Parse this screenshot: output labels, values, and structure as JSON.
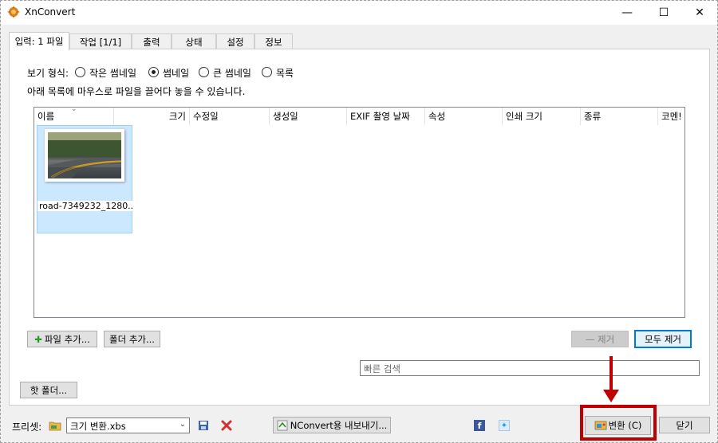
{
  "window": {
    "title": "XnConvert",
    "minimize": "—",
    "maximize": "☐",
    "close": "✕"
  },
  "tabs": [
    {
      "label": "입력: 1 파일",
      "active": true
    },
    {
      "label": "작업 [1/1]",
      "active": false
    },
    {
      "label": "출력",
      "active": false
    },
    {
      "label": "상태",
      "active": false
    },
    {
      "label": "설정",
      "active": false
    },
    {
      "label": "정보",
      "active": false
    }
  ],
  "view": {
    "label": "보기 형식:",
    "options": [
      {
        "label": "작은 썸네일",
        "selected": false
      },
      {
        "label": "썸네일",
        "selected": true
      },
      {
        "label": "큰 썸네일",
        "selected": false
      },
      {
        "label": "목록",
        "selected": false
      }
    ],
    "hint": "아래 목록에 마우스로 파일을 끌어다 놓을 수 있습니다."
  },
  "list": {
    "columns": [
      "이름",
      "크기",
      "수정일",
      "생성일",
      "EXIF 촬영 날짜",
      "속성",
      "인쇄 크기",
      "종류",
      "코멘!"
    ],
    "items": [
      {
        "caption": "road-7349232_1280..."
      }
    ]
  },
  "buttons": {
    "add_files": "파일 추가...",
    "add_folder": "폴더 추가...",
    "remove": "— 제거",
    "remove_all": "모두 제거",
    "hot_folder": "핫 폴더...",
    "export_nconvert": "NConvert용 내보내기...",
    "convert": "변환 (C)",
    "close": "닫기"
  },
  "search": {
    "placeholder": "빠른 검색"
  },
  "preset": {
    "label": "프리셋:",
    "value": "크기 변환.xbs"
  },
  "colors": {
    "highlight": "#c00000",
    "selection": "#cce8ff",
    "default_border": "#0078d7"
  }
}
